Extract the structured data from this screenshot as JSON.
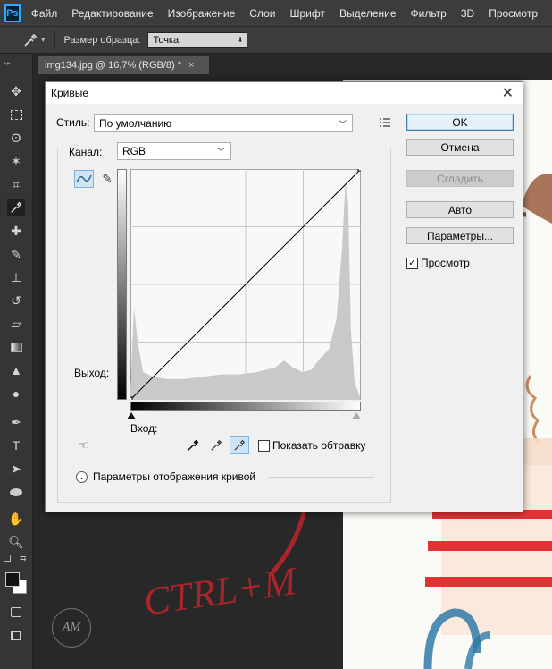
{
  "menu": {
    "logo": "Ps",
    "items": [
      "Файл",
      "Редактирование",
      "Изображение",
      "Слои",
      "Шрифт",
      "Выделение",
      "Фильтр",
      "3D",
      "Просмотр"
    ]
  },
  "options_bar": {
    "tool_icon": "eyedropper-icon",
    "sample_size_label": "Размер образца:",
    "sample_size_value": "Точка"
  },
  "document_tab": {
    "title": "img134.jpg @ 16,7% (RGB/8) *",
    "close_glyph": "×"
  },
  "toolbar": {
    "tools": [
      "move-icon",
      "marquee-icon",
      "lasso-icon",
      "magic-wand-icon",
      "crop-icon",
      "eyedropper-icon",
      "spot-healing-icon",
      "brush-icon",
      "stamp-icon",
      "history-brush-icon",
      "eraser-icon",
      "gradient-icon",
      "blur-icon",
      "dodge-icon",
      "pen-icon",
      "type-icon",
      "path-selection-icon",
      "ellipse-icon",
      "hand-icon",
      "zoom-icon"
    ],
    "foreground_color": "#111111",
    "background_color": "#ffffff"
  },
  "dialog": {
    "title": "Кривые",
    "style_label": "Стиль:",
    "style_value": "По умолчанию",
    "channel_label": "Канал:",
    "channel_value": "RGB",
    "output_label": "Выход:",
    "input_label": "Вход:",
    "buttons": {
      "ok": "OK",
      "cancel": "Отмена",
      "smooth": "Сгладить",
      "auto": "Авто",
      "options": "Параметры..."
    },
    "preview_label": "Просмотр",
    "preview_checked": true,
    "show_clipping_label": "Показать обтравку",
    "show_clipping_checked": false,
    "curve_display_options_label": "Параметры отображения кривой"
  },
  "annotation": {
    "text": "CTRL+M",
    "color": "#a8262b"
  },
  "chart_data": {
    "type": "area",
    "title": "",
    "xlabel": "Вход:",
    "ylabel": "Выход:",
    "xlim": [
      0,
      255
    ],
    "ylim": [
      0,
      255
    ],
    "grid": true,
    "curve": [
      [
        0,
        0
      ],
      [
        255,
        255
      ]
    ],
    "histogram": [
      [
        0,
        0.05
      ],
      [
        4,
        0.4
      ],
      [
        8,
        0.25
      ],
      [
        14,
        0.12
      ],
      [
        25,
        0.1
      ],
      [
        40,
        0.09
      ],
      [
        60,
        0.09
      ],
      [
        80,
        0.1
      ],
      [
        100,
        0.11
      ],
      [
        120,
        0.11
      ],
      [
        140,
        0.12
      ],
      [
        160,
        0.14
      ],
      [
        170,
        0.17
      ],
      [
        180,
        0.14
      ],
      [
        190,
        0.12
      ],
      [
        200,
        0.13
      ],
      [
        210,
        0.18
      ],
      [
        220,
        0.22
      ],
      [
        228,
        0.35
      ],
      [
        234,
        0.65
      ],
      [
        238,
        0.95
      ],
      [
        241,
        0.85
      ],
      [
        244,
        0.3
      ],
      [
        248,
        0.08
      ],
      [
        255,
        0.0
      ]
    ]
  }
}
